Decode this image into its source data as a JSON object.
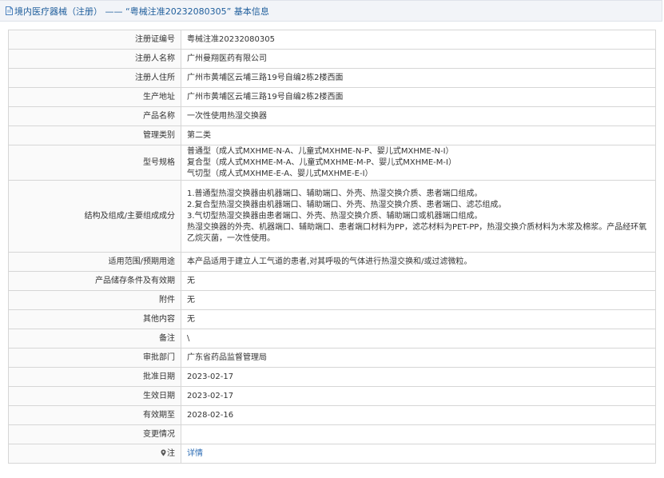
{
  "header": {
    "title": "境内医疗器械（注册） —— “粤械注准20232080305” 基本信息",
    "icon": "document-icon"
  },
  "rows": [
    {
      "label": "注册证编号",
      "lines": [
        "粤械注准20232080305"
      ]
    },
    {
      "label": "注册人名称",
      "lines": [
        "广州曼翔医药有限公司"
      ]
    },
    {
      "label": "注册人住所",
      "lines": [
        "广州市黄埔区云埔三路19号自编2栋2楼西面"
      ]
    },
    {
      "label": "生产地址",
      "lines": [
        "广州市黄埔区云埔三路19号自编2栋2楼西面"
      ]
    },
    {
      "label": "产品名称",
      "lines": [
        "一次性使用热湿交换器"
      ]
    },
    {
      "label": "管理类别",
      "lines": [
        "第二类"
      ]
    },
    {
      "label": "型号规格",
      "lines": [
        "普通型（成人式MXHME-N-A、儿童式MXHME-N-P、婴儿式MXHME-N-I）",
        "复合型（成人式MXHME-M-A、儿童式MXHME-M-P、婴儿式MXHME-M-I）",
        "气切型（成人式MXHME-E-A、婴儿式MXHME-E-I）"
      ]
    },
    {
      "label": "结构及组成/主要组成成分",
      "lines": [
        "1.普通型热湿交换器由机器端口、辅助端口、外壳、热湿交换介质、患者端口组成。",
        "2.复合型热湿交换器由机器端口、辅助端口、外壳、热湿交换介质、患者端口、滤芯组成。",
        "3.气切型热湿交换器由患者端口、外壳、热湿交换介质、辅助端口或机器端口组成。",
        "热湿交换器的外壳、机器端口、辅助端口、患者端口材料为PP，滤芯材料为PET-PP，热湿交换介质材料为木浆及棉浆。产品经环氧乙烷灭菌，一次性使用。"
      ]
    },
    {
      "label": "适用范围/预期用途",
      "lines": [
        "本产品适用于建立人工气道的患者,对其呼吸的气体进行热湿交换和/或过滤微粒。"
      ]
    },
    {
      "label": "产品储存条件及有效期",
      "lines": [
        "无"
      ]
    },
    {
      "label": "附件",
      "lines": [
        "无"
      ]
    },
    {
      "label": "其他内容",
      "lines": [
        "无"
      ]
    },
    {
      "label": "备注",
      "lines": [
        "\\"
      ]
    },
    {
      "label": "审批部门",
      "lines": [
        "广东省药品监督管理局"
      ]
    },
    {
      "label": "批准日期",
      "lines": [
        "2023-02-17"
      ]
    },
    {
      "label": "生效日期",
      "lines": [
        "2023-02-17"
      ]
    },
    {
      "label": "有效期至",
      "lines": [
        "2028-02-16"
      ]
    },
    {
      "label": "变更情况",
      "lines": [
        ""
      ]
    }
  ],
  "note_row": {
    "label": "注",
    "icon": "location-pin-icon",
    "link_text": "详情"
  },
  "colors": {
    "header_bg": "#f2f4f8",
    "header_text": "#1f5e9c",
    "border": "#d6d6d6",
    "link": "#2e6db4"
  }
}
